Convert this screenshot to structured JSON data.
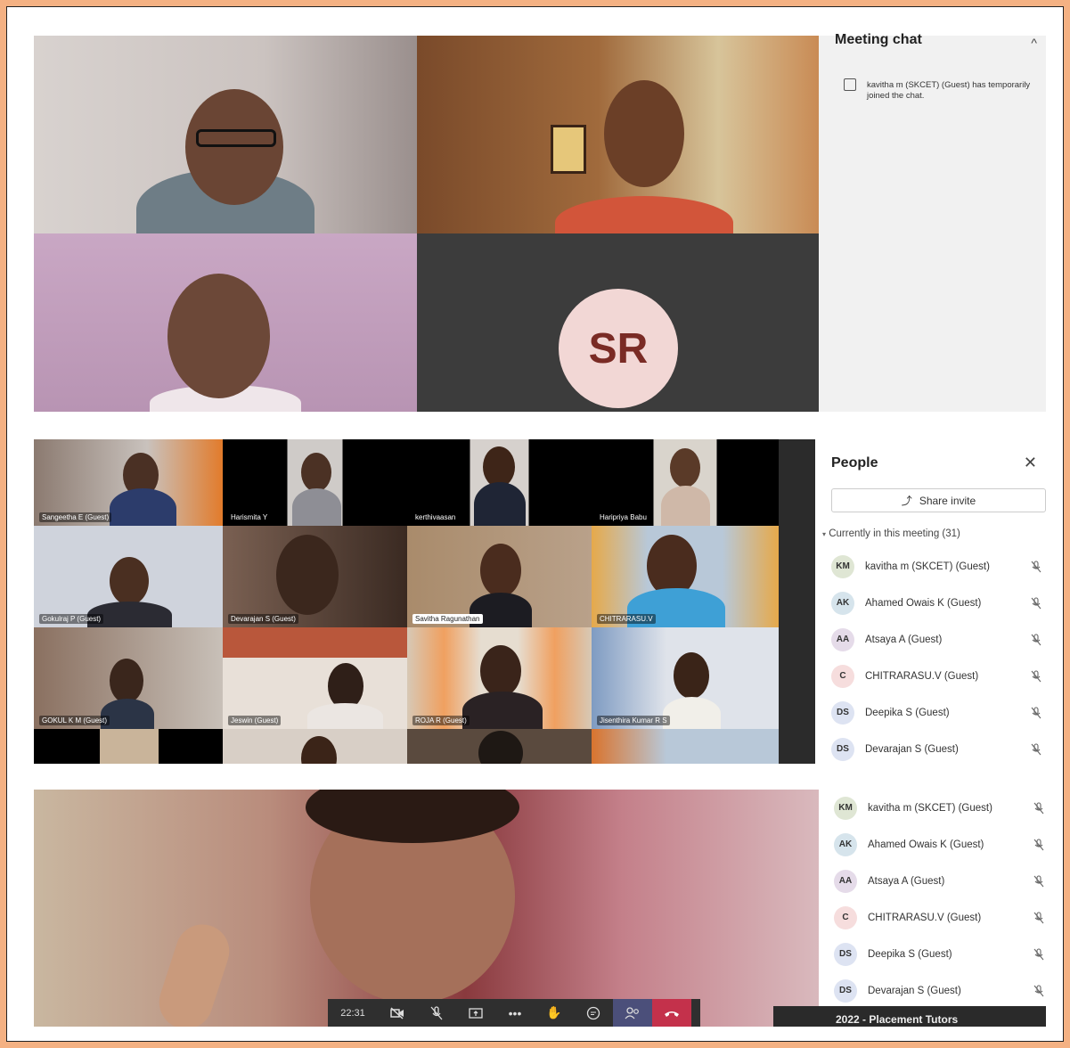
{
  "panel1": {
    "avatar_initials": "SR",
    "chat": {
      "title": "Meeting chat",
      "close_icon": "close-icon",
      "message": "kavitha m (SKCET) (Guest) has temporarily joined the chat."
    }
  },
  "panel2": {
    "tiles": [
      "Sangeetha E (Guest)",
      "Harismita Y",
      "kerthivaasan",
      "Haripriya Babu",
      "Gokulraj P (Guest)",
      "Devarajan S (Guest)",
      "Savitha Ragunathan",
      "CHITRARASU.V",
      "GOKUL K M (Guest)",
      "Jeswin (Guest)",
      "ROJA R (Guest)",
      "Jisenthira Kumar R S"
    ],
    "people": {
      "title": "People",
      "share_label": "Share invite",
      "current_label": "Currently in this meeting (31)",
      "participants": [
        {
          "initials": "KM",
          "name": "kavitha m (SKCET) (Guest)",
          "color": "#dfe6d4"
        },
        {
          "initials": "AK",
          "name": "Ahamed Owais K (Guest)",
          "color": "#d6e4ec"
        },
        {
          "initials": "AA",
          "name": "Atsaya A (Guest)",
          "color": "#e5dbe9"
        },
        {
          "initials": "C",
          "name": "CHITRARASU.V (Guest)",
          "color": "#f6dddd"
        },
        {
          "initials": "DS",
          "name": "Deepika S (Guest)",
          "color": "#dde3f2"
        },
        {
          "initials": "DS",
          "name": "Devarajan S (Guest)",
          "color": "#dde3f2"
        }
      ]
    }
  },
  "panel3": {
    "participants": [
      {
        "initials": "KM",
        "name": "kavitha m (SKCET) (Guest)",
        "color": "#dfe6d4"
      },
      {
        "initials": "AK",
        "name": "Ahamed Owais K (Guest)",
        "color": "#d6e4ec"
      },
      {
        "initials": "AA",
        "name": "Atsaya A (Guest)",
        "color": "#e5dbe9"
      },
      {
        "initials": "C",
        "name": "CHITRARASU.V (Guest)",
        "color": "#f6dddd"
      },
      {
        "initials": "DS",
        "name": "Deepika S (Guest)",
        "color": "#dde3f2"
      },
      {
        "initials": "DS",
        "name": "Devarajan S (Guest)",
        "color": "#dde3f2"
      }
    ],
    "toolbar": {
      "time": "22:31",
      "icons": [
        "camera-off-icon",
        "mic-off-icon",
        "share-screen-icon",
        "more-icon",
        "raise-hand-icon",
        "chat-icon",
        "people-icon",
        "leave-call-icon"
      ]
    },
    "bottom_text": "2022 - Placement Tutors"
  }
}
